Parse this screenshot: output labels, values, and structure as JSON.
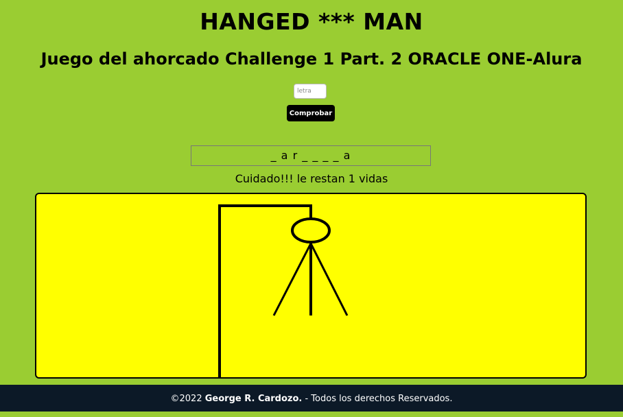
{
  "header": {
    "title": "HANGED *** MAN",
    "subtitle": "Juego del ahorcado Challenge 1 Part. 2 ORACLE ONE-Alura"
  },
  "input": {
    "placeholder": "letra",
    "value": ""
  },
  "check_button_label": "Comprobar",
  "word_display": "_ a r _ _ _ _ a",
  "status_message": "Cuidado!!! le restan 1 vidas",
  "drawing": {
    "parts_shown": [
      "gallows-post",
      "gallows-beam",
      "rope",
      "head",
      "body",
      "left-leg",
      "right-leg"
    ],
    "panel_color": "#ffff00"
  },
  "footer": {
    "copyright": "©2022",
    "author": "George R. Cardozo.",
    "rights": "- Todos los derechos Reservados."
  },
  "colors": {
    "page_background": "#9acd32",
    "footer_background": "#0c1927",
    "button_background": "#000000"
  }
}
